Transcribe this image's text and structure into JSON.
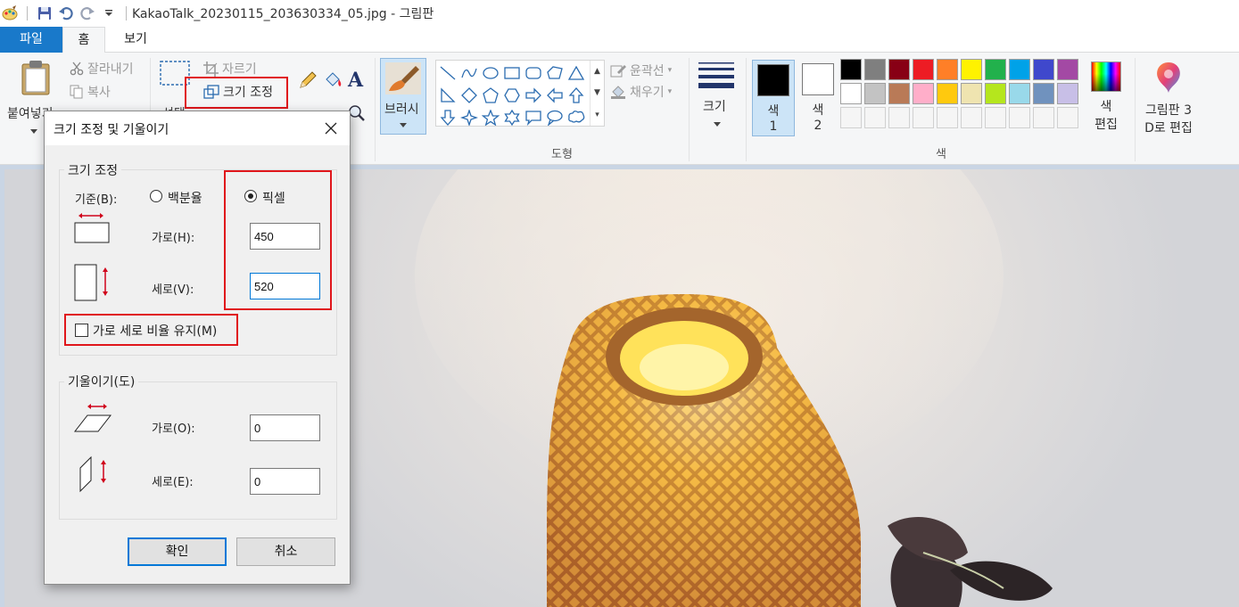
{
  "window": {
    "title": "KakaoTalk_20230115_203630334_05.jpg - 그림판"
  },
  "tabs": [
    {
      "label": "파일"
    },
    {
      "label": "홈"
    },
    {
      "label": "보기"
    }
  ],
  "ribbon": {
    "clipboard": {
      "paste": "붙여넣기",
      "cut": "잘라내기",
      "copy": "복사"
    },
    "image": {
      "select": "선택",
      "crop": "자르기",
      "resize": "크기 조정"
    },
    "brush": "브러시",
    "shapes": {
      "group": "도형",
      "outline": "윤곽선",
      "fill": "채우기"
    },
    "size": "크기",
    "colors": {
      "group": "색",
      "color1_label": "색",
      "color1_num": "1",
      "color2_label": "색",
      "color2_num": "2",
      "edit_line1": "색",
      "edit_line2": "편집",
      "color1_value": "#000000",
      "color2_value": "#ffffff",
      "palette": [
        "#000000",
        "#7f7f7f",
        "#880015",
        "#ed1c24",
        "#ff7f27",
        "#fff200",
        "#22b14c",
        "#00a2e8",
        "#3f48cc",
        "#a349a4",
        "#ffffff",
        "#c3c3c3",
        "#b97a57",
        "#ffaec9",
        "#ffc90e",
        "#efe4b0",
        "#b5e61d",
        "#99d9ea",
        "#7092be",
        "#c8bfe7",
        "#f5f5f5",
        "#f5f5f5",
        "#f5f5f5",
        "#f5f5f5",
        "#f5f5f5",
        "#f5f5f5",
        "#f5f5f5",
        "#f5f5f5",
        "#f5f5f5",
        "#f5f5f5"
      ]
    },
    "paint3d": {
      "line1": "그림판 3",
      "line2": "D로 편집"
    }
  },
  "dialog": {
    "title": "크기 조정 및 기울이기",
    "resize": {
      "legend": "크기 조정",
      "basis_label": "기준(B):",
      "percent_label": "백분율",
      "pixel_label": "픽셀",
      "selected_basis": "pixel",
      "horizontal_label": "가로(H):",
      "horizontal_value": "450",
      "vertical_label": "세로(V):",
      "vertical_value": "520",
      "keep_ratio_label": "가로 세로 비율 유지(M)",
      "keep_ratio_checked": false
    },
    "skew": {
      "legend": "기울이기(도)",
      "horizontal_label": "가로(O):",
      "horizontal_value": "0",
      "vertical_label": "세로(E):",
      "vertical_value": "0"
    },
    "ok_label": "확인",
    "cancel_label": "취소"
  }
}
